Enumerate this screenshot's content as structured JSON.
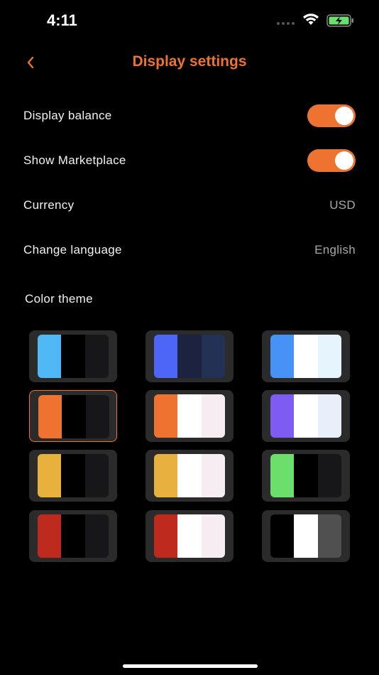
{
  "status_bar": {
    "time": "4:11"
  },
  "nav": {
    "title": "Display settings",
    "back_icon": "chevron-left-icon"
  },
  "settings": {
    "display_balance": {
      "label": "Display balance",
      "enabled": true
    },
    "show_marketplace": {
      "label": "Show Marketplace",
      "enabled": true
    },
    "currency": {
      "label": "Currency",
      "value": "USD"
    },
    "language": {
      "label": "Change language",
      "value": "English"
    }
  },
  "color_theme": {
    "label": "Color theme",
    "selected_index": 3,
    "accent": "#ee7331",
    "themes": [
      {
        "colors": [
          "#4fb8f5",
          "#000000",
          "#17171a"
        ]
      },
      {
        "colors": [
          "#4d66f5",
          "#1b2340",
          "#233154"
        ]
      },
      {
        "colors": [
          "#4792f7",
          "#ffffff",
          "#e6f4fe"
        ]
      },
      {
        "colors": [
          "#ee7331",
          "#000000",
          "#17171a"
        ]
      },
      {
        "colors": [
          "#ee7331",
          "#ffffff",
          "#f6ecf2"
        ]
      },
      {
        "colors": [
          "#7d5cf4",
          "#ffffff",
          "#e9eefb"
        ]
      },
      {
        "colors": [
          "#e8b03c",
          "#000000",
          "#17171a"
        ]
      },
      {
        "colors": [
          "#e8b03c",
          "#ffffff",
          "#f6ecf2"
        ]
      },
      {
        "colors": [
          "#6adf6c",
          "#000000",
          "#17171a"
        ]
      },
      {
        "colors": [
          "#bf2a1e",
          "#000000",
          "#17171a"
        ]
      },
      {
        "colors": [
          "#bf2a1e",
          "#ffffff",
          "#f6ecf2"
        ]
      },
      {
        "colors": [
          "#000000",
          "#ffffff",
          "#505050"
        ]
      }
    ]
  }
}
